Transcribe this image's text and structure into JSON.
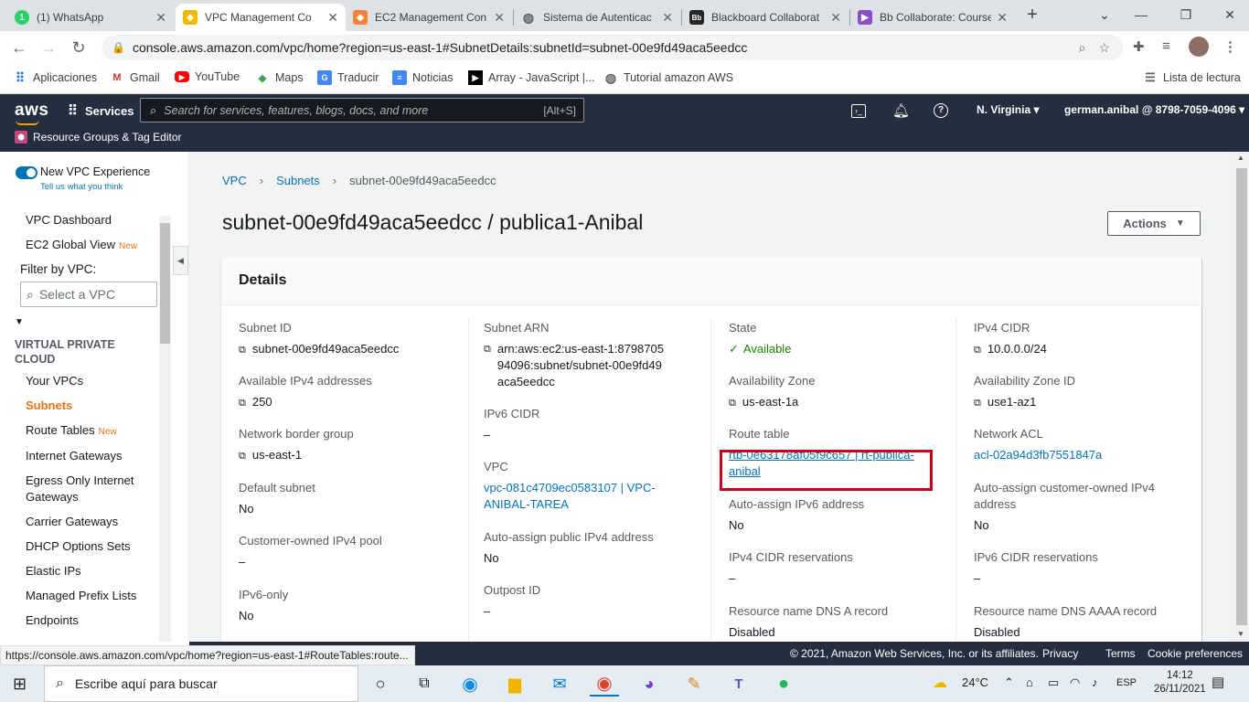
{
  "browser": {
    "tabs": [
      {
        "title": "(1) WhatsApp",
        "icon": "whatsapp-icon",
        "color": "#25d366"
      },
      {
        "title": "VPC Management Co",
        "icon": "vpc-cube-icon",
        "color": "#f5b700"
      },
      {
        "title": "EC2 Management Con",
        "icon": "ec2-cube-icon",
        "color": "#f58534"
      },
      {
        "title": "Sistema de Autenticac",
        "icon": "globe-icon",
        "color": "#5f6368"
      },
      {
        "title": "Blackboard Collaborat",
        "icon": "blackboard-icon",
        "color": "#262626"
      },
      {
        "title": "Bb Collaborate: Course",
        "icon": "collaborate-icon",
        "color": "#8a4fc6"
      }
    ],
    "url": "console.aws.amazon.com/vpc/home?region=us-east-1#SubnetDetails:subnetId=subnet-00e9fd49aca5eedcc",
    "bookmarks": [
      {
        "label": "Aplicaciones",
        "icon": "apps-grid-icon"
      },
      {
        "label": "Gmail",
        "icon": "gmail-icon"
      },
      {
        "label": "YouTube",
        "icon": "youtube-icon"
      },
      {
        "label": "Maps",
        "icon": "maps-icon"
      },
      {
        "label": "Traducir",
        "icon": "translate-icon"
      },
      {
        "label": "Noticias",
        "icon": "news-icon"
      },
      {
        "label": "Array - JavaScript |...",
        "icon": "mdn-icon"
      },
      {
        "label": "Tutorial amazon AWS",
        "icon": "globe-icon"
      }
    ],
    "reading_list": "Lista de lectura",
    "status_url": "https://console.aws.amazon.com/vpc/home?region=us-east-1#RouteTables:route..."
  },
  "aws_header": {
    "logo": "aws",
    "services": "Services",
    "search_placeholder": "Search for services, features, blogs, docs, and more",
    "search_shortcut": "[Alt+S]",
    "region": "N. Virginia",
    "account": "german.anibal @ 8798-7059-4096",
    "resource_groups": "Resource Groups & Tag Editor"
  },
  "sidebar": {
    "new_experience": "New VPC Experience",
    "feedback": "Tell us what you think",
    "top_items": [
      {
        "label": "VPC Dashboard",
        "new": ""
      },
      {
        "label": "EC2 Global View",
        "new": "New"
      }
    ],
    "filter_label": "Filter by VPC:",
    "filter_placeholder": "Select a VPC",
    "section": "VIRTUAL PRIVATE CLOUD",
    "items": [
      {
        "label": "Your VPCs",
        "new": ""
      },
      {
        "label": "Subnets",
        "new": ""
      },
      {
        "label": "Route Tables",
        "new": "New"
      },
      {
        "label": "Internet Gateways",
        "new": ""
      },
      {
        "label": "Egress Only Internet Gateways",
        "new": ""
      },
      {
        "label": "Carrier Gateways",
        "new": ""
      },
      {
        "label": "DHCP Options Sets",
        "new": ""
      },
      {
        "label": "Elastic IPs",
        "new": ""
      },
      {
        "label": "Managed Prefix Lists",
        "new": ""
      },
      {
        "label": "Endpoints",
        "new": ""
      }
    ]
  },
  "breadcrumb": [
    "VPC",
    "Subnets",
    "subnet-00e9fd49aca5eedcc"
  ],
  "page_title": "subnet-00e9fd49aca5eedcc / publica1-Anibal",
  "actions_label": "Actions",
  "details": {
    "heading": "Details",
    "col1": [
      {
        "label": "Subnet ID",
        "value": "subnet-00e9fd49aca5eedcc"
      },
      {
        "label": "Available IPv4 addresses",
        "value": "250"
      },
      {
        "label": "Network border group",
        "value": "us-east-1"
      },
      {
        "label": "Default subnet",
        "value": "No"
      },
      {
        "label": "Customer-owned IPv4 pool",
        "value": "–"
      },
      {
        "label": "IPv6-only",
        "value": "No"
      }
    ],
    "col2": [
      {
        "label": "Subnet ARN",
        "value": "arn:aws:ec2:us-east-1:879870594096:subnet/subnet-00e9fd49aca5eedcc"
      },
      {
        "label": "IPv6 CIDR",
        "value": "–"
      },
      {
        "label": "VPC",
        "value": "vpc-081c4709ec0583107 | VPC-ANIBAL-TAREA"
      },
      {
        "label": "Auto-assign public IPv4 address",
        "value": "No"
      },
      {
        "label": "Outpost ID",
        "value": "–"
      }
    ],
    "col3": [
      {
        "label": "State",
        "value": "Available"
      },
      {
        "label": "Availability Zone",
        "value": "us-east-1a"
      },
      {
        "label": "Route table",
        "value": "rtb-0e63178af05f9c657 | rt-publica-anibal"
      },
      {
        "label": "Auto-assign IPv6 address",
        "value": "No"
      },
      {
        "label": "IPv4 CIDR reservations",
        "value": "–"
      },
      {
        "label": "Resource name DNS A record",
        "value": "Disabled"
      }
    ],
    "col4": [
      {
        "label": "IPv4 CIDR",
        "value": "10.0.0.0/24"
      },
      {
        "label": "Availability Zone ID",
        "value": "use1-az1"
      },
      {
        "label": "Network ACL",
        "value": "acl-02a94d3fb7551847a"
      },
      {
        "label": "Auto-assign customer-owned IPv4 address",
        "value": "No"
      },
      {
        "label": "IPv6 CIDR reservations",
        "value": "–"
      },
      {
        "label": "Resource name DNS AAAA record",
        "value": "Disabled"
      }
    ]
  },
  "footer": {
    "copyright": "© 2021, Amazon Web Services, Inc. or its affiliates.",
    "privacy": "Privacy",
    "terms": "Terms",
    "cookies": "Cookie preferences"
  },
  "taskbar": {
    "search_placeholder": "Escribe aquí para buscar",
    "weather": "24°C",
    "lang": "ESP",
    "time": "14:12",
    "date": "26/11/2021"
  },
  "colors": {
    "aws_dark": "#232f3e",
    "aws_orange": "#ec7211",
    "link_blue": "#0073bb",
    "highlight_red": "#d0021b",
    "available_green": "#1d8102"
  }
}
